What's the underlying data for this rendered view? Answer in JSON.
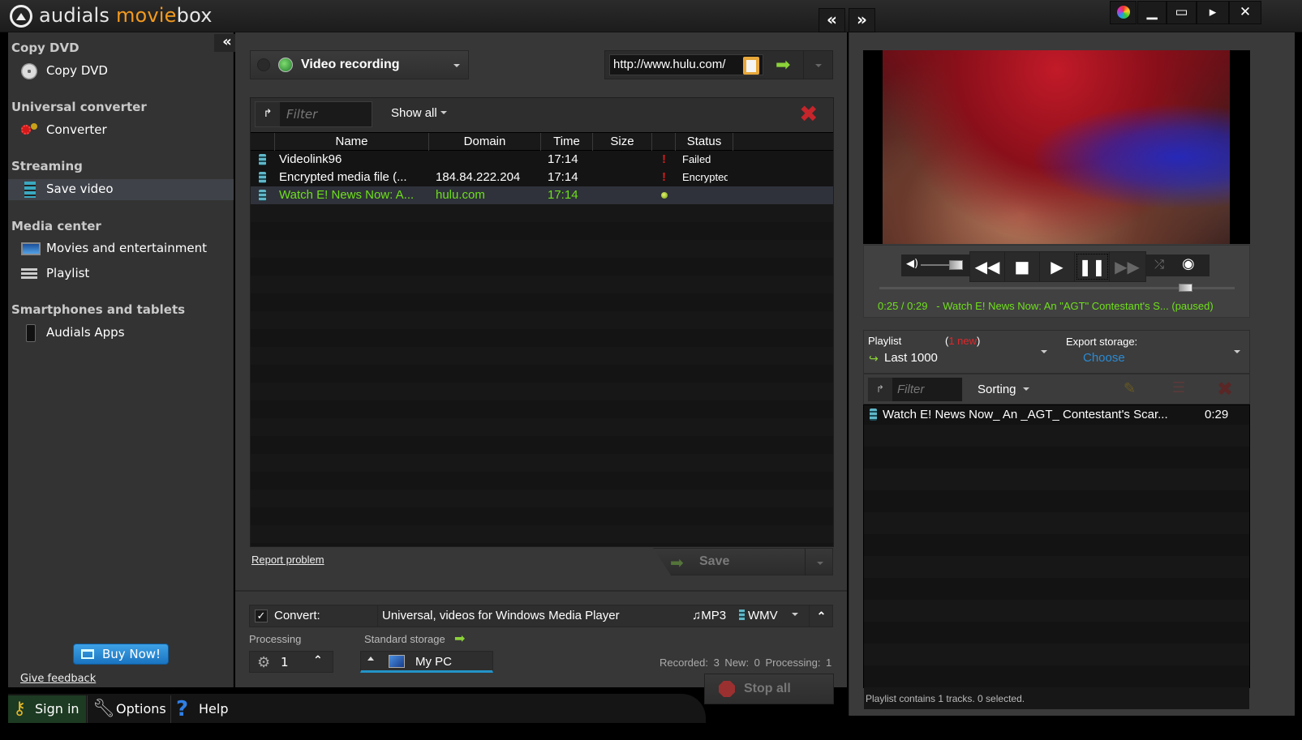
{
  "app": {
    "title_part1": "audials ",
    "title_part2": "movie",
    "title_part3": "box",
    "nav_back": "«",
    "nav_forward": "»",
    "window_buttons": [
      "skin",
      "minimize",
      "maximize",
      "mini-player",
      "close"
    ],
    "window_glyphs": {
      "minimize": "▁",
      "maximize": "▭",
      "mini_player": "▸",
      "close": "✕"
    }
  },
  "sidebar": {
    "collapse": "«",
    "sections": [
      {
        "heading": "Copy DVD",
        "items": [
          {
            "label": "Copy DVD",
            "icon": "dvd-copy-icon"
          }
        ]
      },
      {
        "heading": "Universal converter",
        "items": [
          {
            "label": "Converter",
            "icon": "converter-gears-icon"
          }
        ]
      },
      {
        "heading": "Streaming",
        "items": [
          {
            "label": "Save video",
            "icon": "film-strip-icon",
            "active": true
          }
        ]
      },
      {
        "heading": "Media center",
        "items": [
          {
            "label": "Movies and entertainment",
            "icon": "tv-icon"
          },
          {
            "label": "Playlist",
            "icon": "list-icon"
          }
        ]
      },
      {
        "heading": "Smartphones and tablets",
        "items": [
          {
            "label": "Audials Apps",
            "icon": "smartphone-icon"
          }
        ]
      }
    ],
    "buy_now": "Buy Now!",
    "give_feedback": "Give feedback"
  },
  "bottom_bar": {
    "sign_in": "Sign in",
    "options": "Options",
    "help": "Help"
  },
  "recording": {
    "mode": "Video recording",
    "url_value": "http://www.hulu.com/",
    "filter_placeholder": "Filter",
    "show_all": "Show all",
    "columns": [
      "Name",
      "Domain",
      "Time",
      "Size",
      "",
      "Status"
    ],
    "rows": [
      {
        "name": "Videolink96",
        "domain": "",
        "time": "17:14",
        "size": "",
        "indicator": "!",
        "status": "Failed",
        "selected": false
      },
      {
        "name": "Encrypted media file (...",
        "domain": "184.84.222.204",
        "time": "17:14",
        "size": "",
        "indicator": "!",
        "status": "Encrypted",
        "selected": false
      },
      {
        "name": "Watch E! News Now: A...",
        "domain": "hulu.com",
        "time": "17:14",
        "size": "",
        "indicator": "dot",
        "status": "",
        "selected": true
      }
    ],
    "report_problem": "Report problem",
    "save": "Save"
  },
  "convert": {
    "checked": true,
    "check_mark": "✓",
    "label": "Convert:",
    "profile": "Universal, videos for Windows Media Player",
    "audio_format": "♫MP3",
    "video_format": "WMV",
    "processing_label": "Processing",
    "processing_count": "1",
    "storage_label": "Standard storage",
    "storage_value": "My PC",
    "counters": "Recorded: 3  New: 0  Processing: 1",
    "stop_all": "Stop all"
  },
  "player": {
    "position": "0:25",
    "duration": "0:29",
    "progress_fraction": 0.862,
    "volume_fraction": 0.9,
    "now_playing": "0:25 / 0:29   - Watch E! News Now: An \"AGT\" Contestant's S... (paused)",
    "glyphs": {
      "rewind": "◀◀",
      "stop": "■",
      "play": "▶",
      "pause": "❚❚",
      "forward": "▶▶",
      "shuffle": "⤮",
      "eye": "◉",
      "volume": "◀)"
    }
  },
  "playlist": {
    "label": "Playlist",
    "new_count_prefix": "(",
    "new_count": "1 new",
    "new_count_suffix": ")",
    "selected": "Last 1000",
    "export_label": "Export storage:",
    "export_value": "Choose",
    "filter_placeholder": "Filter",
    "sorting": "Sorting",
    "tracks": [
      {
        "title": "Watch E! News Now_ An _AGT_ Contestant's Scar...",
        "duration": "0:29"
      }
    ],
    "status": "Playlist contains 1 tracks. 0 selected."
  },
  "colors": {
    "accent_orange": "#f39a1e",
    "active_green": "#6ee01b",
    "error_red": "#d41c1c",
    "link_blue": "#2a8bd3"
  }
}
